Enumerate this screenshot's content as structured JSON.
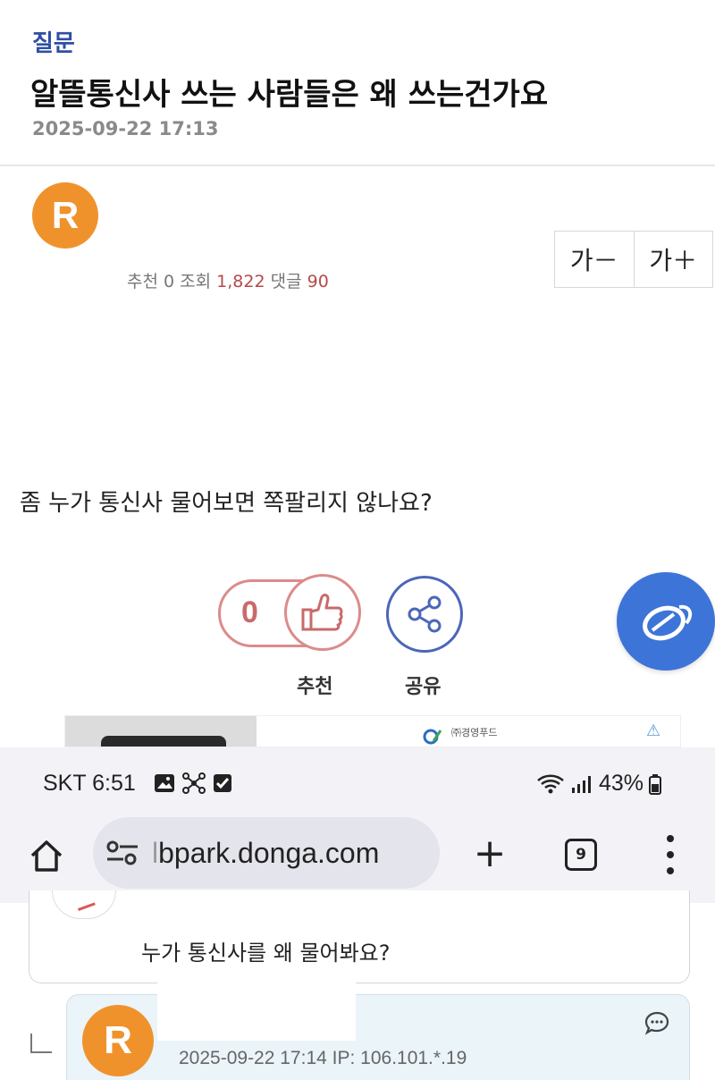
{
  "post": {
    "category": "질문",
    "title": "알뜰통신사 쓰는 사람들은 왜 쓰는건가요",
    "datetime": "2025-09-22 17:13",
    "author_initial": "R",
    "body": "좀 누가 통신사 물어보면 쪽팔리지 않나요?"
  },
  "font_controls": {
    "decrease": "가－",
    "increase": "가＋"
  },
  "stats": {
    "recommend_label": "추천",
    "recommend_value": "0",
    "views_label": "조회",
    "views_value": "1,822",
    "comments_label": "댓글",
    "comments_value": "90"
  },
  "actions": {
    "recommend_count": "0",
    "recommend_label": "추천",
    "share_label": "공유"
  },
  "ad": {
    "brand": "㈜경영푸드"
  },
  "status_bar": {
    "carrier_time": "SKT 6:51",
    "battery": "43%"
  },
  "browser": {
    "url_hidden": "l",
    "url": "bpark.donga.com",
    "tab_count": "9"
  },
  "comments": [
    {
      "text": "누가 통신사를 왜 물어봐요?"
    },
    {
      "author_initial": "R",
      "meta": "2025-09-22 17:14  IP: 106.101.*.19"
    }
  ],
  "icons": {
    "recommend": "thumbs-up-icon",
    "share": "share-icon",
    "fab": "floating-logo-icon",
    "home": "home-icon",
    "menu": "more-vert-icon"
  },
  "colors": {
    "category": "#2f4fa3",
    "avatar": "#f0922b",
    "recommend": "#dc8b8b",
    "share": "#4c66b8",
    "fab": "#3d74d8",
    "stat_highlight": "#b44a4a"
  }
}
